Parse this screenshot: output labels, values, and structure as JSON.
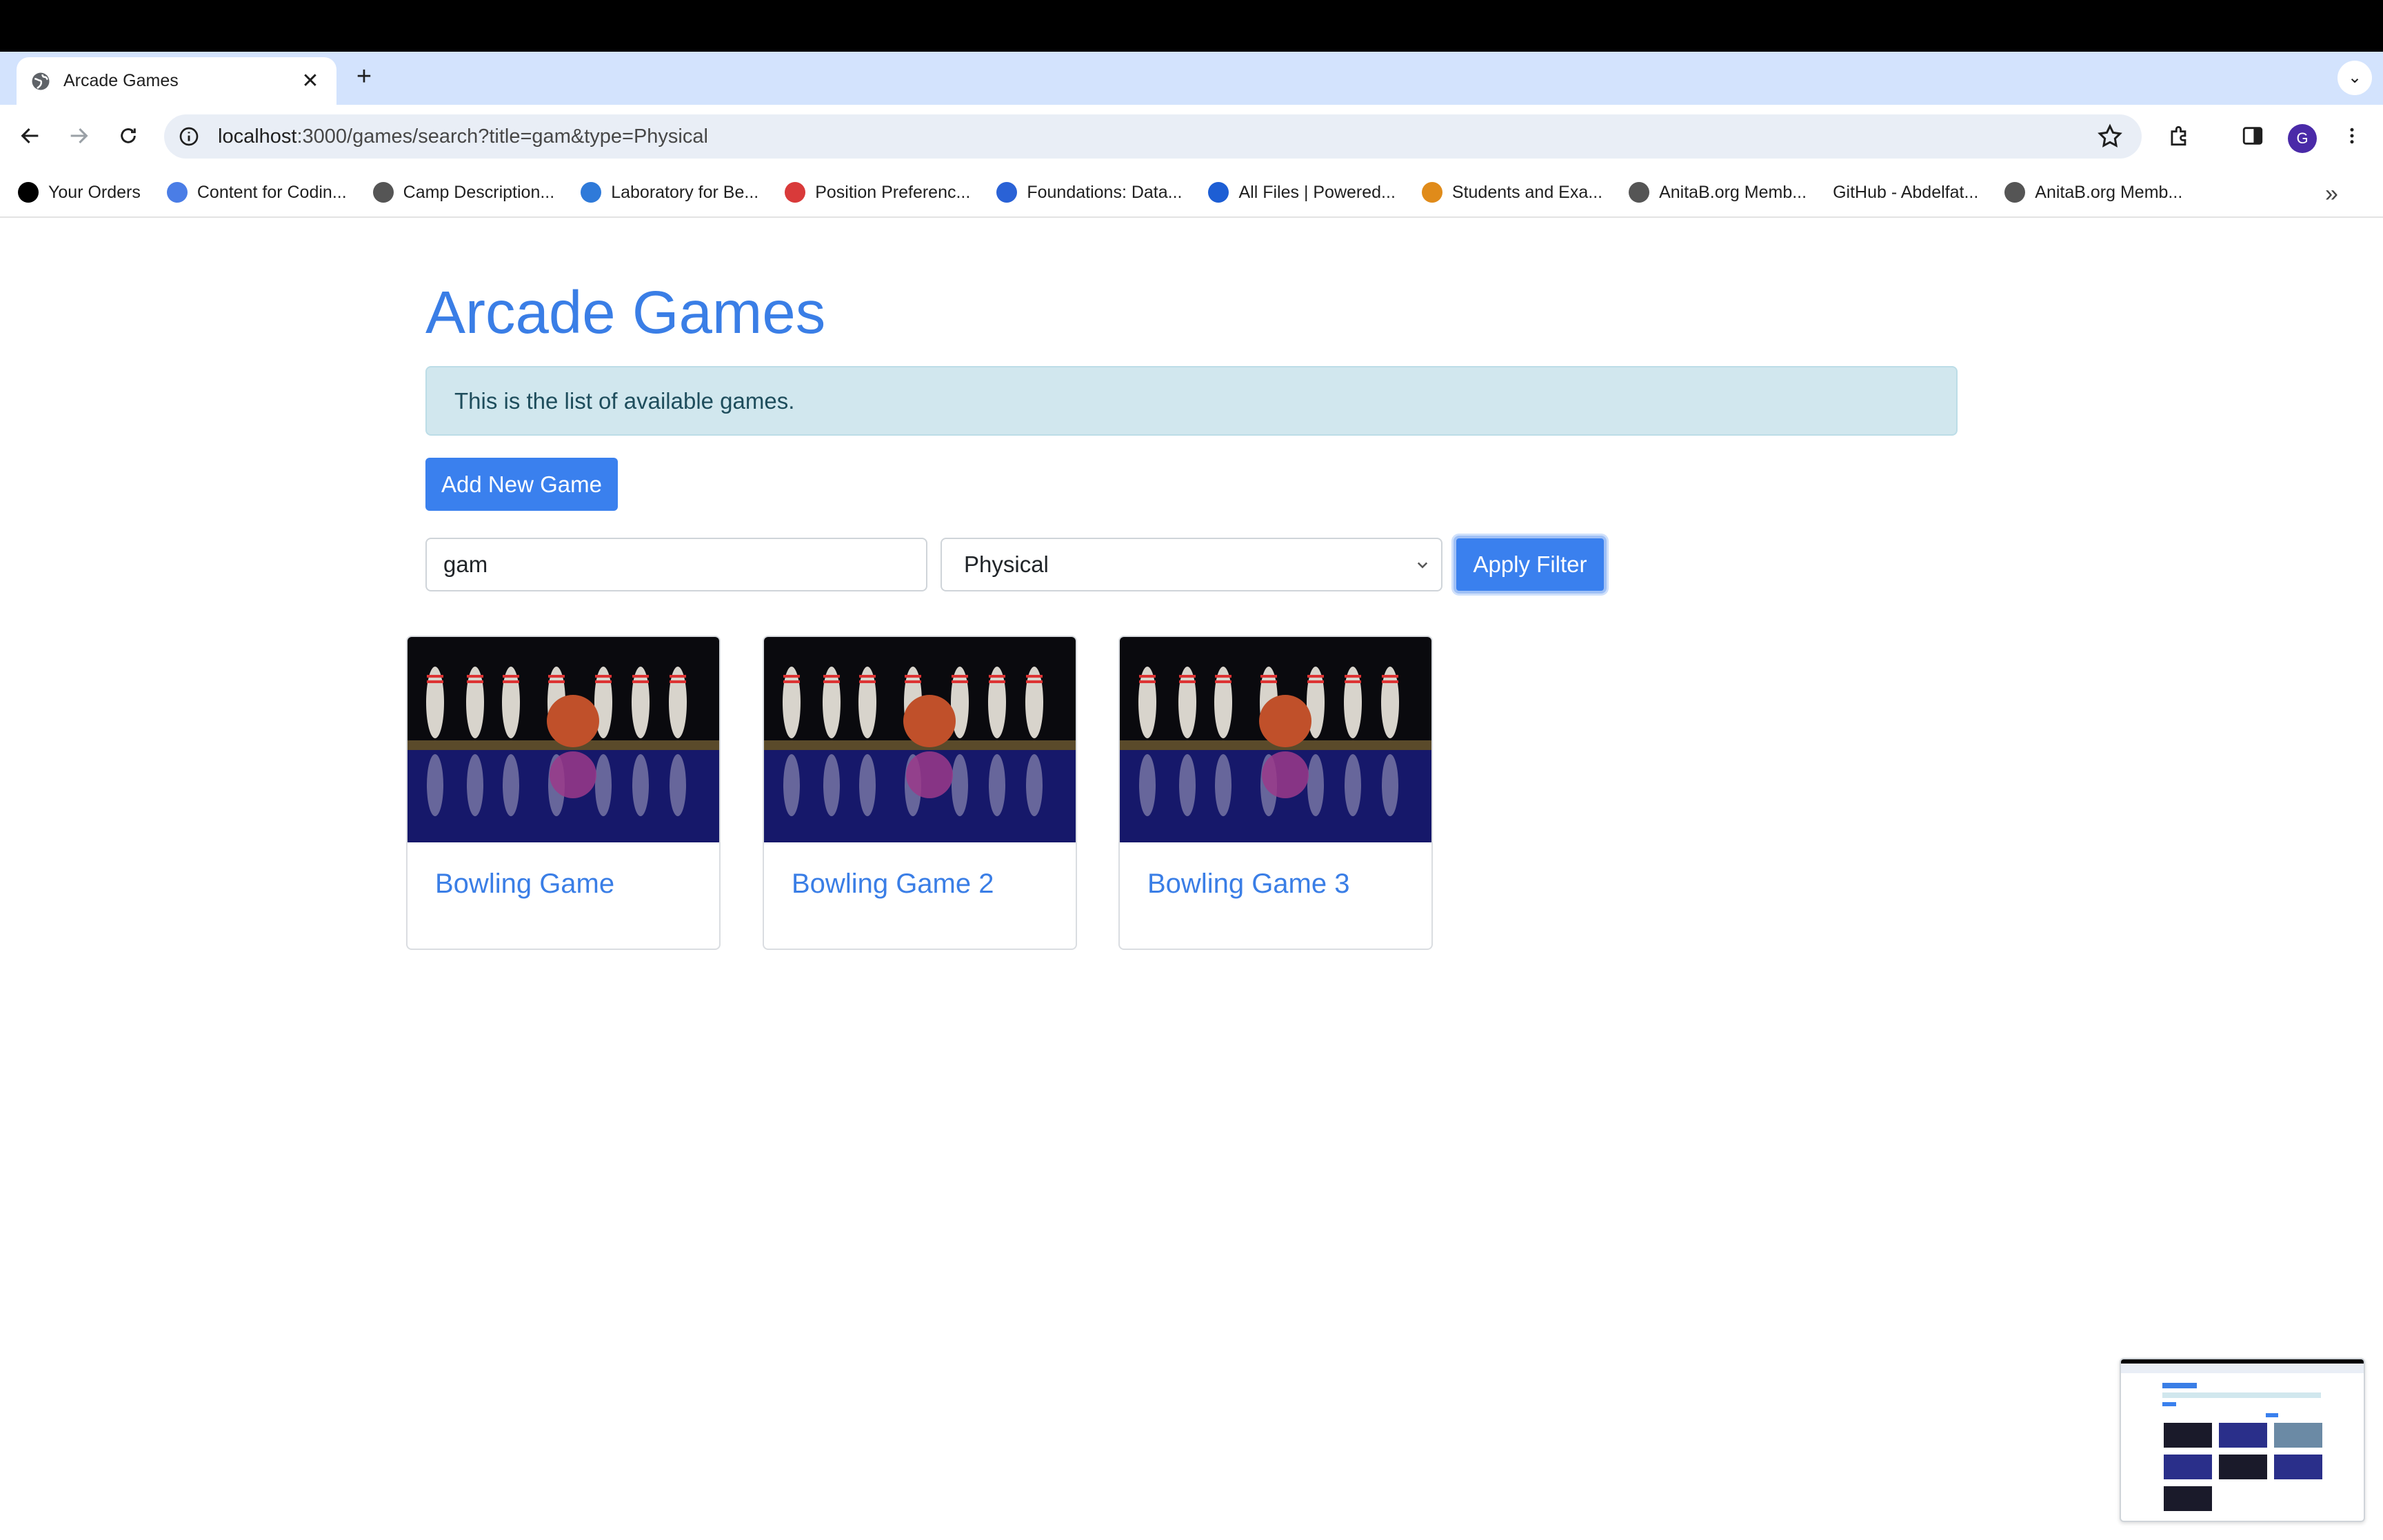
{
  "browser": {
    "tab_title": "Arcade Games",
    "url_host": "localhost",
    "url_rest": ":3000/games/search?title=gam&type=Physical",
    "avatar_letter": "G",
    "bookmarks": [
      {
        "label": "Your Orders",
        "icon": "amazon-icon",
        "color": "#000000"
      },
      {
        "label": "Content for Codin...",
        "icon": "docs-icon",
        "color": "#4a7de6"
      },
      {
        "label": "Camp Description...",
        "icon": "globe-icon",
        "color": "#555555"
      },
      {
        "label": "Laboratory for Be...",
        "icon": "lab-icon",
        "color": "#2f7ad9"
      },
      {
        "label": "Position Preferenc...",
        "icon": "opera-icon",
        "color": "#d93a3a"
      },
      {
        "label": "Foundations: Data...",
        "icon": "coursera-icon",
        "color": "#2a62d6"
      },
      {
        "label": "All Files | Powered...",
        "icon": "box-icon",
        "color": "#1d5ed4"
      },
      {
        "label": "Students and Exa...",
        "icon": "moodle-icon",
        "color": "#e08b1a"
      },
      {
        "label": "AnitaB.org Memb...",
        "icon": "globe-icon",
        "color": "#555555"
      },
      {
        "label": "GitHub - Abdelfat...",
        "icon": "",
        "color": ""
      },
      {
        "label": "AnitaB.org Memb...",
        "icon": "globe-icon",
        "color": "#555555"
      }
    ]
  },
  "page": {
    "title": "Arcade Games",
    "alert_text": "This is the list of available games.",
    "add_button": "Add New Game",
    "search_value": "gam",
    "type_value": "Physical",
    "apply_button": "Apply Filter",
    "games": [
      {
        "title": "Bowling Game"
      },
      {
        "title": "Bowling Game 2"
      },
      {
        "title": "Bowling Game 3"
      }
    ]
  },
  "colors": {
    "accent": "#3a7ee6",
    "alert_bg": "#d1e7ee"
  }
}
